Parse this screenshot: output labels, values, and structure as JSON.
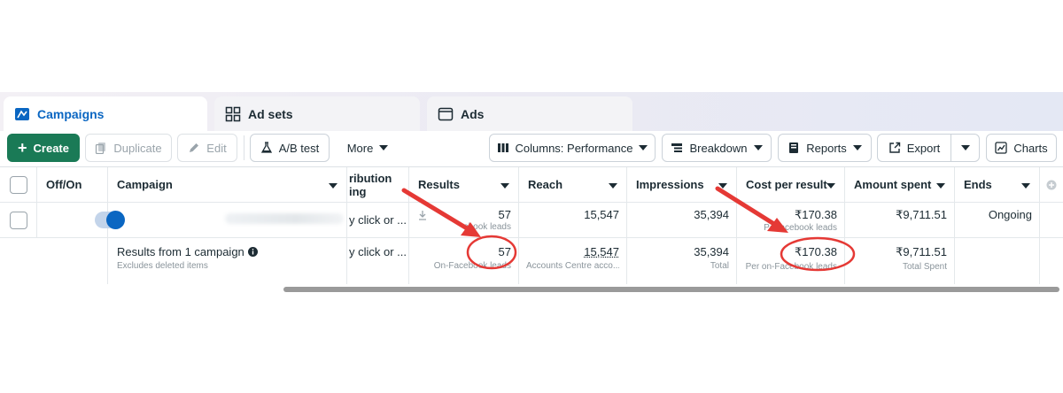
{
  "tabs": [
    {
      "label": "Campaigns",
      "icon": "campaign-flag-icon"
    },
    {
      "label": "Ad sets",
      "icon": "grid-icon"
    },
    {
      "label": "Ads",
      "icon": "window-icon"
    }
  ],
  "toolbar": {
    "create": "Create",
    "duplicate": "Duplicate",
    "edit": "Edit",
    "ab_test": "A/B test",
    "more": "More",
    "columns": "Columns: Performance",
    "breakdown": "Breakdown",
    "reports": "Reports",
    "export": "Export",
    "charts": "Charts"
  },
  "table": {
    "headers": {
      "off_on": "Off/On",
      "campaign": "Campaign",
      "attribution_1": "ribution",
      "attribution_2": "ing",
      "results": "Results",
      "reach": "Reach",
      "impressions": "Impressions",
      "cost_per_result": "Cost per result",
      "amount_spent": "Amount spent",
      "ends": "Ends"
    },
    "row1": {
      "attribution": "y click or ...",
      "results": "57",
      "results_sub": "ebook leads",
      "reach": "15,547",
      "impressions": "35,394",
      "cost_per_result": "₹170.38",
      "cost_sub": "Per      acebook leads",
      "amount_spent": "₹9,711.51",
      "ends": "Ongoing"
    },
    "summary": {
      "title": "Results from 1 campaign",
      "subtitle": "Excludes deleted items",
      "attribution": "y click or ...",
      "results": "57",
      "results_sub": "On-Facebook leads",
      "reach": "15,547",
      "reach_sub": "Accounts Centre acco...",
      "impressions": "35,394",
      "impressions_sub": "Total",
      "cost_per_result": "₹170.38",
      "cost_sub": "Per on-Facebook leads",
      "amount_spent": "₹9,711.51",
      "amount_sub": "Total Spent"
    }
  },
  "colors": {
    "accent": "#0a66c2",
    "create_button": "#1a7a56",
    "annotation": "#e53935"
  }
}
